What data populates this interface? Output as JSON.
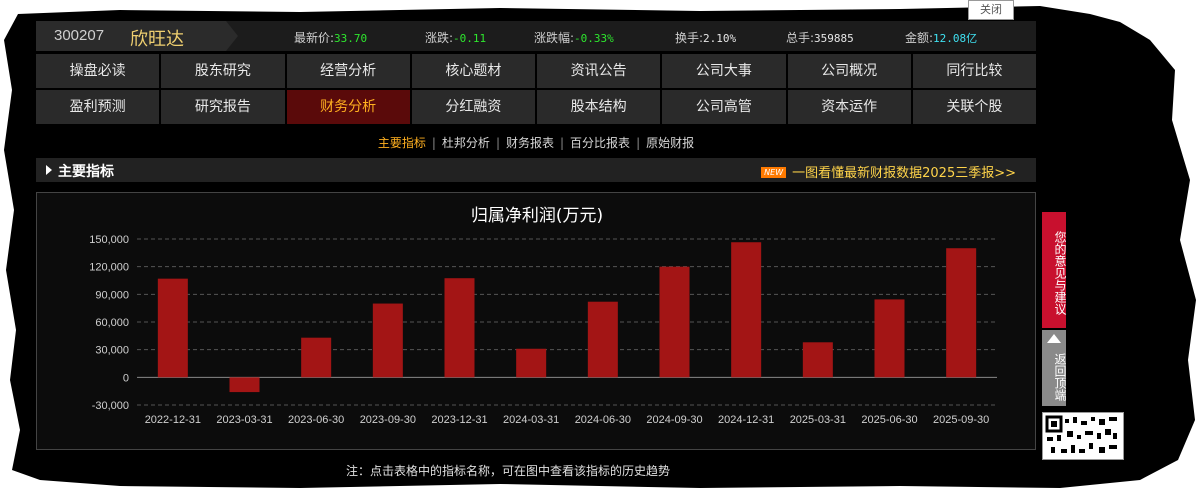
{
  "corner_tab": "关闭",
  "stock": {
    "code": "300207",
    "name": "欣旺达"
  },
  "quote": [
    {
      "label": "最新价:",
      "value": "33.70",
      "color": "#2ee62e"
    },
    {
      "label": "涨跌:",
      "value": "-0.11",
      "color": "#2ee62e"
    },
    {
      "label": "涨跌幅:",
      "value": "-0.33%",
      "color": "#2ee62e"
    },
    {
      "label": "换手:",
      "value": "2.10%",
      "color": "#e6e6e6"
    },
    {
      "label": "总手:",
      "value": "359885",
      "color": "#e6e6e6"
    },
    {
      "label": "金额:",
      "value": "12.08亿",
      "color": "#3fe0f0"
    }
  ],
  "nav": {
    "row1": [
      "操盘必读",
      "股东研究",
      "经营分析",
      "核心题材",
      "资讯公告",
      "公司大事",
      "公司概况",
      "同行比较"
    ],
    "row2": [
      "盈利预测",
      "研究报告",
      "财务分析",
      "分红融资",
      "股本结构",
      "公司高管",
      "资本运作",
      "关联个股"
    ],
    "active": "财务分析"
  },
  "subtabs": {
    "items": [
      "主要指标",
      "杜邦分析",
      "财务报表",
      "百分比报表",
      "原始财报"
    ],
    "active": "主要指标"
  },
  "section": {
    "title": "主要指标",
    "promo_badge": "NEW",
    "promo_text": "一图看懂最新财报数据2025三季报>>"
  },
  "chart_data": {
    "type": "bar",
    "title": "归属净利润(万元)",
    "xlabel": "",
    "ylabel": "",
    "categories": [
      "2022-12-31",
      "2023-03-31",
      "2023-06-30",
      "2023-09-30",
      "2023-12-31",
      "2024-03-31",
      "2024-06-30",
      "2024-09-30",
      "2024-12-31",
      "2025-03-31",
      "2025-06-30",
      "2025-09-30"
    ],
    "values": [
      107000,
      -16000,
      43000,
      80000,
      107500,
      31000,
      82000,
      120000,
      146500,
      38000,
      84500,
      140000
    ],
    "ylim": [
      -30000,
      150000
    ],
    "yticks": [
      -30000,
      0,
      30000,
      60000,
      90000,
      120000,
      150000
    ],
    "ytick_labels": [
      "-30,000",
      "0",
      "30,000",
      "60,000",
      "90,000",
      "120,000",
      "150,000"
    ],
    "grid": true,
    "bar_color": "#a31515"
  },
  "side": {
    "feedback": "您的意见与建议",
    "backtop": "返回顶端"
  },
  "footnote": "注：点击表格中的指标名称，可在图中查看该指标的历史趋势"
}
